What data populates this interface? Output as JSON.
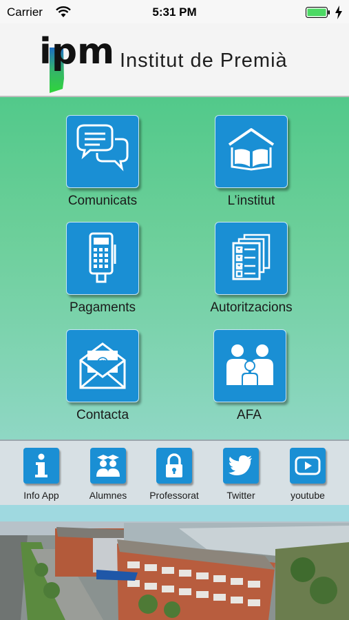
{
  "status_bar": {
    "carrier": "Carrier",
    "time": "5:31 PM"
  },
  "header": {
    "logo_text": "ipm",
    "title": "Institut de Premià"
  },
  "menu": {
    "items": [
      {
        "label": "Comunicats",
        "icon": "chat-bubbles-icon"
      },
      {
        "label": "L’institut",
        "icon": "school-book-icon"
      },
      {
        "label": "Pagaments",
        "icon": "payment-terminal-icon"
      },
      {
        "label": "Autoritzacions",
        "icon": "checklist-documents-icon"
      },
      {
        "label": "Contacta",
        "icon": "email-envelope-icon"
      },
      {
        "label": "AFA",
        "icon": "family-icon"
      }
    ]
  },
  "toolbar": {
    "items": [
      {
        "label": "Info App",
        "icon": "info-icon"
      },
      {
        "label": "Alumnes",
        "icon": "students-icon"
      },
      {
        "label": "Professorat",
        "icon": "lock-icon"
      },
      {
        "label": "Twitter",
        "icon": "twitter-icon"
      },
      {
        "label": "youtube",
        "icon": "youtube-icon"
      }
    ]
  },
  "colors": {
    "tile_blue": "#1a8fd4",
    "green_top": "#52c98a",
    "green_bottom": "#8fd7c4",
    "toolbar_bg": "#d7e0e4"
  }
}
